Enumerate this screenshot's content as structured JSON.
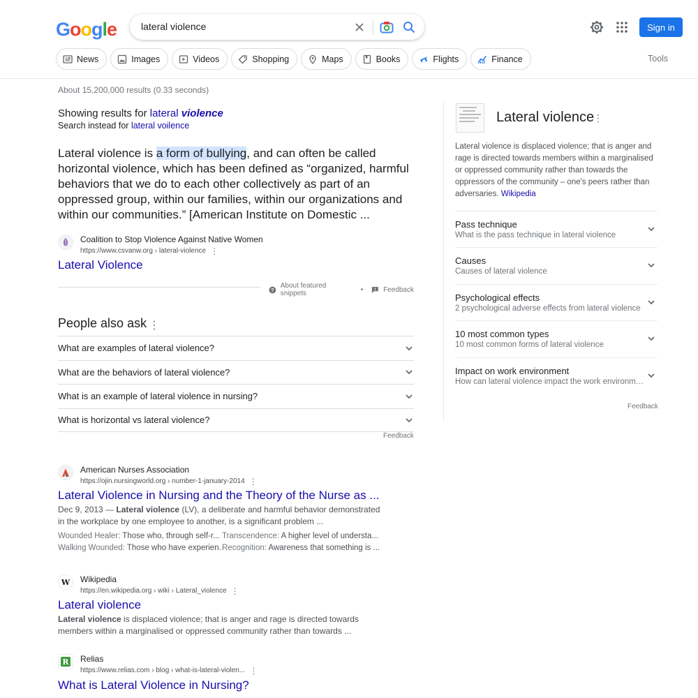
{
  "logo": {
    "text": "Google"
  },
  "search": {
    "query": "lateral violence"
  },
  "header": {
    "signin_label": "Sign in"
  },
  "chips": [
    {
      "label": "News",
      "icon": "news-icon"
    },
    {
      "label": "Images",
      "icon": "images-icon"
    },
    {
      "label": "Videos",
      "icon": "videos-icon"
    },
    {
      "label": "Shopping",
      "icon": "shopping-icon"
    },
    {
      "label": "Maps",
      "icon": "maps-icon"
    },
    {
      "label": "Books",
      "icon": "books-icon"
    },
    {
      "label": "Flights",
      "icon": "flights-icon"
    },
    {
      "label": "Finance",
      "icon": "finance-icon"
    }
  ],
  "tools_label": "Tools",
  "stats": "About 15,200,000 results (0.33 seconds)",
  "correction": {
    "showing_prefix": "Showing results for",
    "showing_word1": "lateral",
    "showing_word2": "violence",
    "instead_prefix": "Search instead for",
    "instead_link": "lateral voilence"
  },
  "featured": {
    "text_before": "Lateral violence is ",
    "text_highlight": "a form of bullying",
    "text_after": ", and can often be called horizontal violence, which has been defined as “organized, harmful behaviors that we do to each other collectively as part of an oppressed group, within our families, within our organizations and within our communities.” [American Institute on Domestic ...",
    "source_name": "Coalition to Stop Violence Against Native Women",
    "source_url": "https://www.csvanw.org › lateral-violence",
    "title": "Lateral Violence",
    "about_label": "About featured snippets",
    "separator": "•",
    "feedback_label": "Feedback"
  },
  "paa": {
    "title": "People also ask",
    "questions": [
      "What are examples of lateral violence?",
      "What are the behaviors of lateral violence?",
      "What is an example of lateral violence in nursing?",
      "What is horizontal vs lateral violence?"
    ],
    "feedback_label": "Feedback"
  },
  "results": [
    {
      "source_name": "American Nurses Association",
      "source_url": "https://ojin.nursingworld.org › number-1-january-2014",
      "title": "Lateral Violence in Nursing and the Theory of the Nurse as ...",
      "date": "Dec 9, 2013 —",
      "bold": "Lateral violence",
      "desc": " (LV), a deliberate and harmful behavior demonstrated in the workplace by one employee to another, is a significant problem ...",
      "sublinks": [
        {
          "k": "Wounded Healer:",
          "v": "Those who, through self-r..."
        },
        {
          "k": "Transcendence:",
          "v": "A higher level of understa..."
        },
        {
          "k": "Walking Wounded:",
          "v": "Those who have experien..."
        },
        {
          "k": "Recognition:",
          "v": "Awareness that something is ..."
        }
      ]
    },
    {
      "source_name": "Wikipedia",
      "source_url": "https://en.wikipedia.org › wiki › Lateral_violence",
      "title": "Lateral violence",
      "bold": "Lateral violence",
      "desc": " is displaced violence; that is anger and rage is directed towards members within a marginalised or oppressed community rather than towards ..."
    },
    {
      "source_name": "Relias",
      "source_url": "https://www.relias.com › blog › what-is-lateral-violen...",
      "title": "What is Lateral Violence in Nursing?"
    }
  ],
  "knowledge_panel": {
    "title": "Lateral violence",
    "desc": "Lateral violence is displaced violence; that is anger and rage is directed towards members within a marginalised or oppressed community rather than towards the oppressors of the community – one's peers rather than adversaries.",
    "desc_link": "Wikipedia",
    "items": [
      {
        "title": "Pass technique",
        "sub": "What is the pass technique in lateral violence"
      },
      {
        "title": "Causes",
        "sub": "Causes of lateral violence"
      },
      {
        "title": "Psychological effects",
        "sub": "2 psychological adverse effects from lateral violence"
      },
      {
        "title": "10 most common types",
        "sub": "10 most common forms of lateral violence"
      },
      {
        "title": "Impact on work environment",
        "sub": "How can lateral violence impact the work environment?"
      }
    ],
    "feedback_label": "Feedback"
  },
  "colors": {
    "link": "#1a0dab",
    "accent": "#1a73e8",
    "highlight": "#d3e3fd"
  }
}
